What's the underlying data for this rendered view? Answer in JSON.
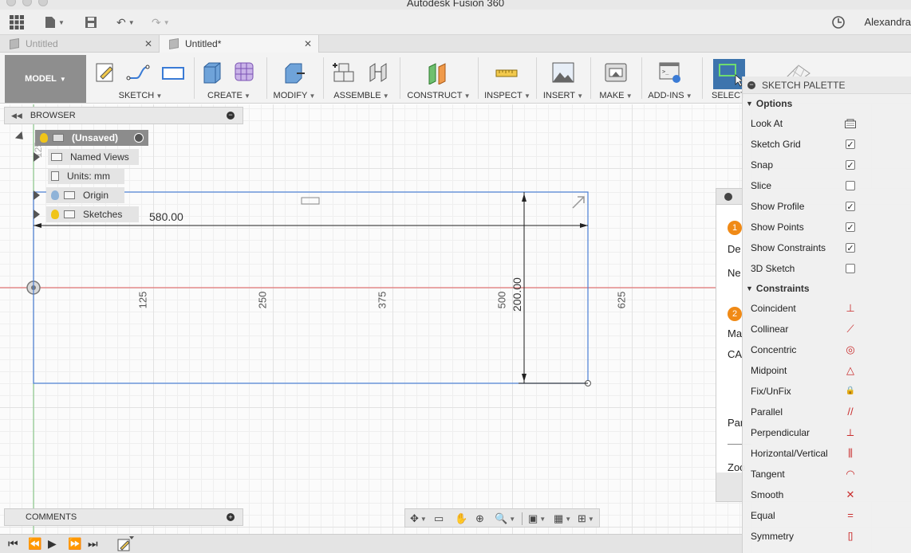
{
  "window": {
    "title": "Autodesk Fusion 360"
  },
  "quickbar": {
    "user": "Alexandra",
    "icons": [
      "grid-menu-icon",
      "file-icon",
      "save-icon",
      "undo-icon",
      "redo-icon",
      "history-clock-icon"
    ]
  },
  "tabs": [
    {
      "label": "Untitled",
      "active": false
    },
    {
      "label": "Untitled*",
      "active": true
    }
  ],
  "toolbar": {
    "workspace": "MODEL",
    "groups": [
      {
        "label": "SKETCH"
      },
      {
        "label": "CREATE"
      },
      {
        "label": "MODIFY"
      },
      {
        "label": "ASSEMBLE"
      },
      {
        "label": "CONSTRUCT"
      },
      {
        "label": "INSPECT"
      },
      {
        "label": "INSERT"
      },
      {
        "label": "MAKE"
      },
      {
        "label": "ADD-INS"
      },
      {
        "label": "SELECT"
      }
    ]
  },
  "browser": {
    "title": "BROWSER",
    "root": "(Unsaved)",
    "items": [
      {
        "label": "Named Views"
      },
      {
        "label": "Units: mm"
      },
      {
        "label": "Origin"
      },
      {
        "label": "Sketches"
      }
    ]
  },
  "sketch": {
    "dim_width": "580.00",
    "dim_height": "200.00",
    "ruler": [
      "125",
      "250",
      "375",
      "500",
      "625"
    ],
    "small_tick": "125"
  },
  "getting_started": {
    "fragments": [
      "De",
      "Ne",
      "Ma",
      "CA",
      "Par",
      "Zoo"
    ],
    "step1": "1",
    "step2": "2"
  },
  "palette": {
    "title": "SKETCH PALETTE",
    "options_label": "Options",
    "options": [
      {
        "label": "Look At",
        "type": "button",
        "checked": false
      },
      {
        "label": "Sketch Grid",
        "type": "checkbox",
        "checked": true
      },
      {
        "label": "Snap",
        "type": "checkbox",
        "checked": true
      },
      {
        "label": "Slice",
        "type": "checkbox",
        "checked": false
      },
      {
        "label": "Show Profile",
        "type": "checkbox",
        "checked": true
      },
      {
        "label": "Show Points",
        "type": "checkbox",
        "checked": true
      },
      {
        "label": "Show Constraints",
        "type": "checkbox",
        "checked": true
      },
      {
        "label": "3D Sketch",
        "type": "checkbox",
        "checked": false
      }
    ],
    "constraints_label": "Constraints",
    "constraints": [
      {
        "label": "Coincident",
        "icon": "coincident-icon",
        "glyph": "⊥"
      },
      {
        "label": "Collinear",
        "icon": "collinear-icon",
        "glyph": "⟋"
      },
      {
        "label": "Concentric",
        "icon": "concentric-icon",
        "glyph": "◎"
      },
      {
        "label": "Midpoint",
        "icon": "midpoint-icon",
        "glyph": "△"
      },
      {
        "label": "Fix/UnFix",
        "icon": "lock-icon",
        "glyph": "🔒"
      },
      {
        "label": "Parallel",
        "icon": "parallel-icon",
        "glyph": "//"
      },
      {
        "label": "Perpendicular",
        "icon": "perpendicular-icon",
        "glyph": "⟂"
      },
      {
        "label": "Horizontal/Vertical",
        "icon": "horizontal-vertical-icon",
        "glyph": "⫼"
      },
      {
        "label": "Tangent",
        "icon": "tangent-icon",
        "glyph": "◠"
      },
      {
        "label": "Smooth",
        "icon": "smooth-icon",
        "glyph": "✕"
      },
      {
        "label": "Equal",
        "icon": "equal-icon",
        "glyph": "="
      },
      {
        "label": "Symmetry",
        "icon": "symmetry-icon",
        "glyph": "[]"
      }
    ]
  },
  "comments": {
    "title": "COMMENTS"
  },
  "colors": {
    "accent": "#3a7bd5",
    "sketch_line": "#4a7fd4",
    "axis_red": "#e05a5a",
    "axis_green": "#7bc47b",
    "constraint": "#c92c2c"
  }
}
